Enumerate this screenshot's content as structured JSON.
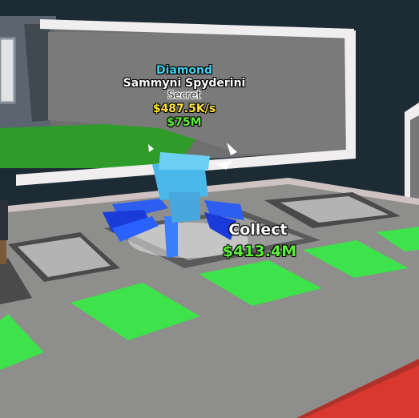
{
  "pet_info": {
    "rarity_label": "Diamond",
    "name": "Sammyni Spyderini",
    "tier": "Secret",
    "income_rate": "$487.5K/s",
    "price": "$75M"
  },
  "collect_prompt": {
    "label": "Collect",
    "amount": "$413.4M"
  },
  "colors": {
    "diamond": "#3fd2f0",
    "income": "#ffe23d",
    "money": "#5cf03a",
    "pad_green": "#3ee24a",
    "floor": "#8d8d8b"
  },
  "icons": [
    "spider-brainrot-pet-icon",
    "player-avatar-icon"
  ]
}
